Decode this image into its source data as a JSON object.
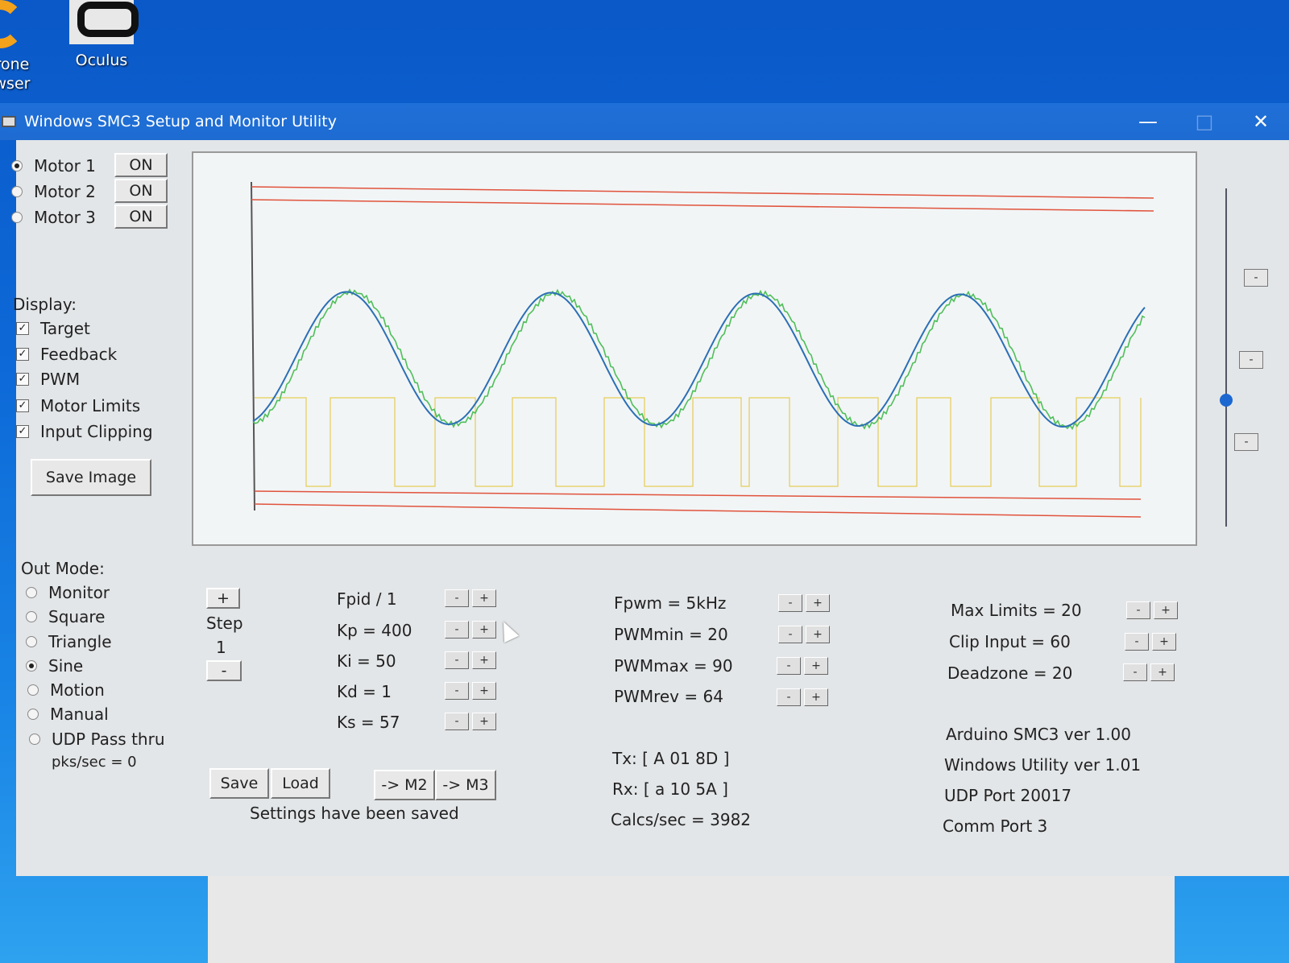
{
  "desktop": {
    "icons": [
      {
        "label_line1": "rone",
        "label_line2": "wser"
      },
      {
        "label_line1": "Oculus",
        "label_line2": ""
      }
    ]
  },
  "window": {
    "title": "Windows SMC3 Setup and Monitor Utility",
    "minimize": "—",
    "maximize": "□",
    "close": "✕"
  },
  "motors": [
    {
      "label": "Motor 1",
      "button": "ON",
      "selected": true
    },
    {
      "label": "Motor 2",
      "button": "ON",
      "selected": false
    },
    {
      "label": "Motor 3",
      "button": "ON",
      "selected": false
    }
  ],
  "display": {
    "heading": "Display:",
    "checks": [
      "Target",
      "Feedback",
      "PWM",
      "Motor Limits",
      "Input Clipping"
    ],
    "save_image": "Save Image"
  },
  "out_mode": {
    "heading": "Out Mode:",
    "options": [
      "Monitor",
      "Square",
      "Triangle",
      "Sine",
      "Motion",
      "Manual",
      "UDP Pass thru"
    ],
    "selected": "Sine",
    "pks": "pks/sec = 0"
  },
  "step": {
    "plus": "+",
    "label": "Step",
    "value": "1",
    "minus": "-"
  },
  "pid": [
    {
      "label": "Fpid / 1"
    },
    {
      "label": "Kp = 400"
    },
    {
      "label": "Ki = 50"
    },
    {
      "label": "Kd = 1"
    },
    {
      "label": "Ks = 57"
    }
  ],
  "pwm": [
    {
      "label": "Fpwm = 5kHz"
    },
    {
      "label": "PWMmin = 20"
    },
    {
      "label": "PWMmax = 90"
    },
    {
      "label": "PWMrev = 64"
    }
  ],
  "limits": [
    {
      "label": "Max Limits = 20"
    },
    {
      "label": "Clip Input = 60"
    },
    {
      "label": "Deadzone = 20"
    }
  ],
  "controls": {
    "minus": "-",
    "plus": "+"
  },
  "actions": {
    "save": "Save",
    "load": "Load",
    "to_m2": "-> M2",
    "to_m3": "-> M3",
    "status": "Settings have been saved"
  },
  "comm": {
    "tx": "Tx: [ A 01 8D ]",
    "rx": "Rx: [ a 10 5A ]",
    "calcs": "Calcs/sec = 3982"
  },
  "info": {
    "arduino": "Arduino SMC3 ver 1.00",
    "utility": "Windows Utility ver 1.01",
    "udp": "UDP Port 20017",
    "comm_port": "Comm Port 3"
  },
  "slider": {
    "level": 0.63
  },
  "colors": {
    "target": "#2b6fb5",
    "feedback": "#4fbf5a",
    "pwm": "#e3c53a",
    "limits": "#e0533c"
  }
}
